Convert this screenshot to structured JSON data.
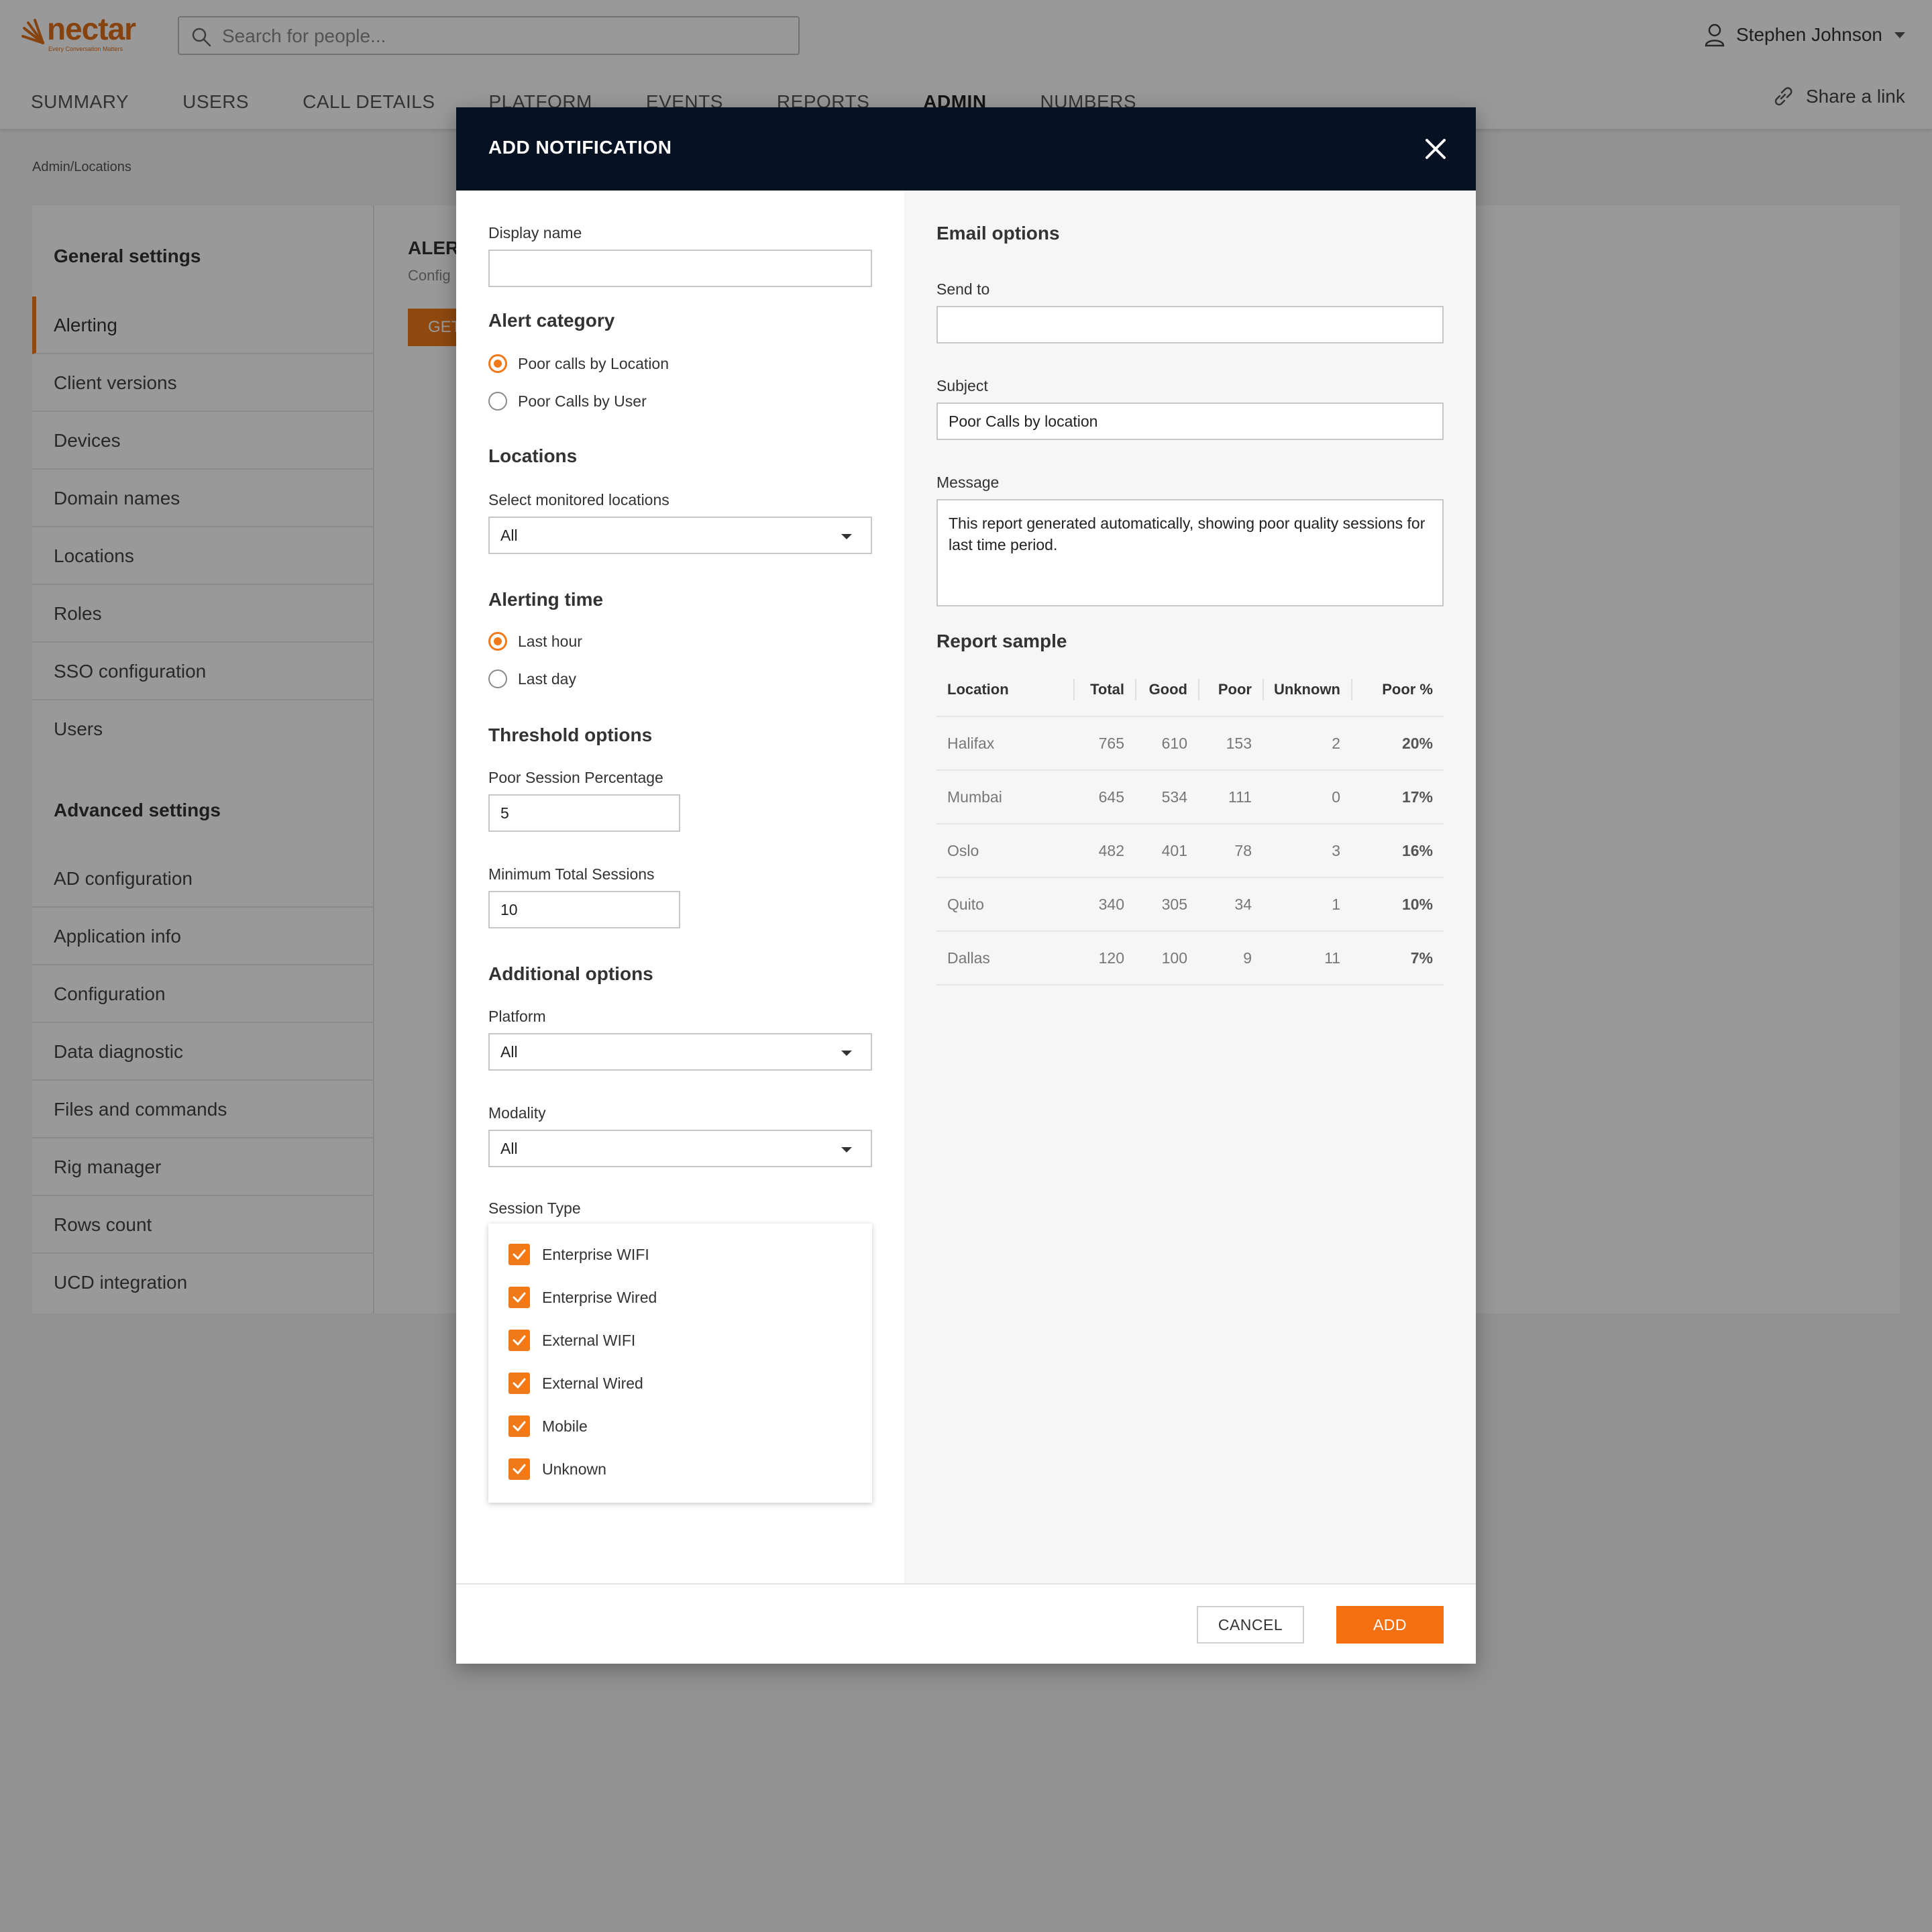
{
  "app": {
    "brand": "nectar",
    "brand_tagline": "Every Conversation Matters",
    "search_placeholder": "Search for people...",
    "user_name": "Stephen Johnson",
    "share_label": "Share a link",
    "nav": [
      "SUMMARY",
      "USERS",
      "CALL DETAILS",
      "PLATFORM",
      "EVENTS",
      "REPORTS",
      "ADMIN",
      "NUMBERS"
    ],
    "active_nav": "ADMIN",
    "breadcrumb": "Admin/Locations",
    "accent_color": "#f07a1a"
  },
  "sidebar": {
    "general_heading": "General settings",
    "general_items": [
      "Alerting",
      "Client versions",
      "Devices",
      "Domain names",
      "Locations",
      "Roles",
      "SSO configuration",
      "Users"
    ],
    "active_item": "Alerting",
    "advanced_heading": "Advanced settings",
    "advanced_items": [
      "AD configuration",
      "Application info",
      "Configuration",
      "Data diagnostic",
      "Files and commands",
      "Rig manager",
      "Rows count",
      "UCD integration"
    ]
  },
  "content": {
    "heading": "ALERT",
    "subtext": "Config",
    "button": "GET"
  },
  "modal": {
    "title": "ADD NOTIFICATION",
    "display_name_label": "Display name",
    "display_name_value": "",
    "alert_category_heading": "Alert category",
    "alert_category_options": [
      "Poor calls by Location",
      "Poor Calls by User"
    ],
    "alert_category_selected": "Poor calls by Location",
    "locations_heading": "Locations",
    "locations_label": "Select monitored locations",
    "locations_value": "All",
    "alerting_time_heading": "Alerting time",
    "alerting_time_options": [
      "Last hour",
      "Last day"
    ],
    "alerting_time_selected": "Last hour",
    "threshold_heading": "Threshold options",
    "poor_session_label": "Poor Session Percentage",
    "poor_session_value": "5",
    "min_sessions_label": "Minimum Total Sessions",
    "min_sessions_value": "10",
    "additional_heading": "Additional options",
    "platform_label": "Platform",
    "platform_value": "All",
    "modality_label": "Modality",
    "modality_value": "All",
    "session_type_label": "Session Type",
    "session_types": [
      "Enterprise WIFI",
      "Enterprise Wired",
      "External WIFI",
      "External Wired",
      "Mobile",
      "Unknown"
    ],
    "email_heading": "Email options",
    "send_to_label": "Send to",
    "send_to_value": "",
    "subject_label": "Subject",
    "subject_value": "Poor Calls by location",
    "message_label": "Message",
    "message_value": "This report generated automatically, showing poor quality sessions for last time period.",
    "report_heading": "Report sample",
    "report_columns": [
      "Location",
      "Total",
      "Good",
      "Poor",
      "Unknown",
      "Poor %"
    ],
    "report_rows": [
      [
        "Halifax",
        "765",
        "610",
        "153",
        "2",
        "20%"
      ],
      [
        "Mumbai",
        "645",
        "534",
        "111",
        "0",
        "17%"
      ],
      [
        "Oslo",
        "482",
        "401",
        "78",
        "3",
        "16%"
      ],
      [
        "Quito",
        "340",
        "305",
        "34",
        "1",
        "10%"
      ],
      [
        "Dallas",
        "120",
        "100",
        "9",
        "11",
        "7%"
      ]
    ],
    "cancel_label": "CANCEL",
    "add_label": "ADD"
  }
}
